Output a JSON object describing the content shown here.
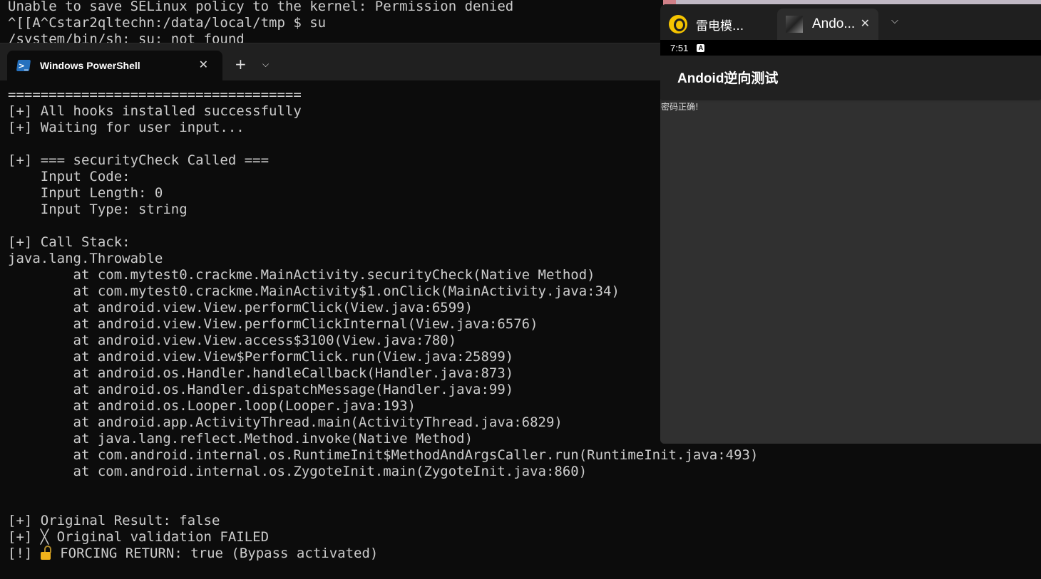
{
  "background_terminal": {
    "lines": [
      "Unable to save SELinux policy to the kernel: Permission denied",
      "^[[A^Cstar2qltechn:/data/local/tmp $ su",
      "/system/bin/sh: su: not found"
    ]
  },
  "powershell": {
    "tab_title": "Windows PowerShell",
    "tab_icon": "powershell-icon",
    "close_glyph": "✕",
    "new_tab_glyph": "+",
    "dropdown_glyph": "⌵",
    "output": [
      "====================================",
      "[+] All hooks installed successfully",
      "[+] Waiting for user input...",
      "",
      "[+] === securityCheck Called ===",
      "    Input Code:",
      "    Input Length: 0",
      "    Input Type: string",
      "",
      "[+] Call Stack:",
      "java.lang.Throwable",
      "        at com.mytest0.crackme.MainActivity.securityCheck(Native Method)",
      "        at com.mytest0.crackme.MainActivity$1.onClick(MainActivity.java:34)",
      "        at android.view.View.performClick(View.java:6599)",
      "        at android.view.View.performClickInternal(View.java:6576)",
      "        at android.view.View.access$3100(View.java:780)",
      "        at android.view.View$PerformClick.run(View.java:25899)",
      "        at android.os.Handler.handleCallback(Handler.java:873)",
      "        at android.os.Handler.dispatchMessage(Handler.java:99)",
      "        at android.os.Looper.loop(Looper.java:193)",
      "        at android.app.ActivityThread.main(ActivityThread.java:6829)",
      "        at java.lang.reflect.Method.invoke(Native Method)",
      "        at com.android.internal.os.RuntimeInit$MethodAndArgsCaller.run(RuntimeInit.java:493)",
      "        at com.android.internal.os.ZygoteInit.main(ZygoteInit.java:860)",
      "",
      "",
      "[+] Original Result: false",
      "[+] ╳ Original validation FAILED"
    ],
    "last_line_prefix": "[!] ",
    "last_line_icon": "unlocked-padlock-icon",
    "last_line_text": " FORCING RETURN: true (Bypass activated)"
  },
  "emulator": {
    "tabs": [
      {
        "label": "雷电模...",
        "icon": "ldplayer-logo-icon"
      },
      {
        "label": "Ando...",
        "icon": "app-thumbnail-icon",
        "close_glyph": "✕"
      }
    ],
    "dropdown_glyph": "⌵",
    "status_bar": {
      "time": "7:51",
      "notif_icon": "a-notification-icon",
      "notif_glyph": "A"
    },
    "app_title": "Andoid逆向测试",
    "result_text": "密码正确!"
  },
  "colors": {
    "terminal_bg": "#0c0c0c",
    "terminal_text": "#cccccc",
    "tabbar_bg": "#202020",
    "android_bg": "#303030",
    "action_bar_bg": "#212121",
    "lock_gold": "#f2b31b"
  }
}
